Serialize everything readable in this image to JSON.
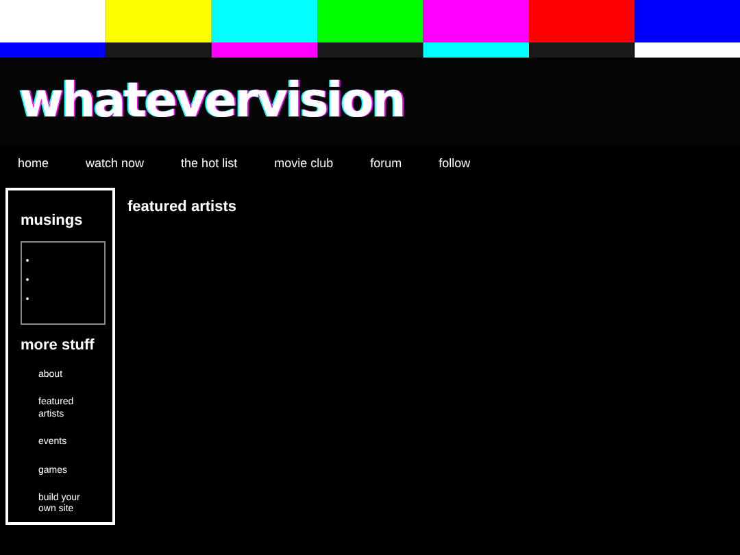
{
  "site_title": "whatevervision",
  "nav": [
    "home",
    "watch now",
    "the hot list",
    "movie club",
    "forum",
    "follow"
  ],
  "sidebar": {
    "musings_title": "musings",
    "musings": [
      {
        "kind": "empty_item"
      },
      {
        "kind": "empty_item"
      },
      {
        "kind": "empty_item"
      }
    ],
    "more_title": "more stuff",
    "links": [
      "about",
      "featured artists",
      "events",
      "games",
      "build your own site"
    ]
  },
  "main": {
    "heading": "featured artists"
  }
}
